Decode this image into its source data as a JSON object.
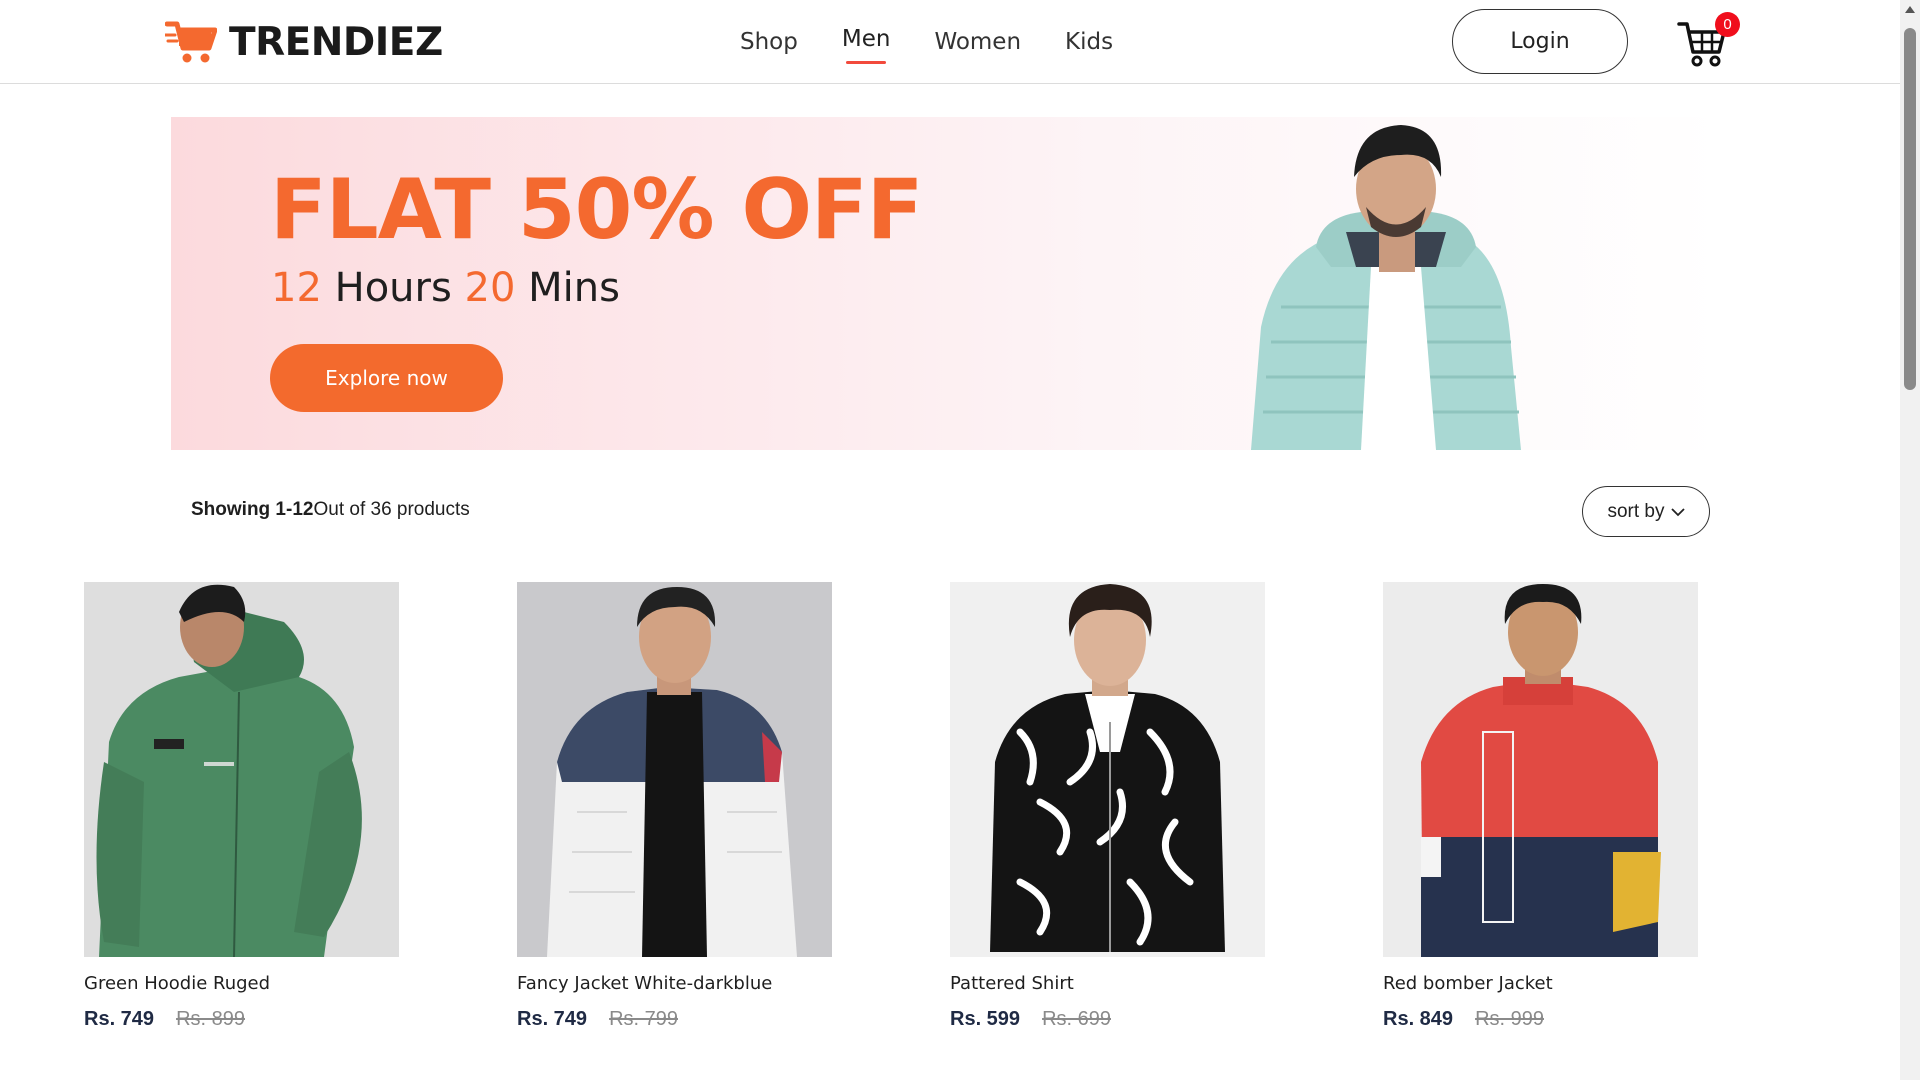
{
  "header": {
    "brand": "TRENDIEZ",
    "nav": [
      {
        "label": "Shop",
        "active": false
      },
      {
        "label": "Men",
        "active": true
      },
      {
        "label": "Women",
        "active": false
      },
      {
        "label": "Kids",
        "active": false
      }
    ],
    "login_label": "Login",
    "cart_count": "0"
  },
  "banner": {
    "title": "FLAT 50% OFF",
    "hours_value": "12",
    "hours_label": "Hours",
    "mins_value": "20",
    "mins_label": "Mins",
    "cta_label": "Explore now"
  },
  "listing": {
    "showing_bold": "Showing 1-12",
    "showing_rest": "Out of 36 products",
    "sort_label": "sort by"
  },
  "products": [
    {
      "name": "Green Hoodie Ruged",
      "price": "Rs. 749",
      "old_price": "Rs. 899"
    },
    {
      "name": "Fancy Jacket White-darkblue",
      "price": "Rs. 749",
      "old_price": "Rs. 799"
    },
    {
      "name": "Pattered Shirt",
      "price": "Rs. 599",
      "old_price": "Rs. 699"
    },
    {
      "name": "Red bomber Jacket",
      "price": "Rs. 849",
      "old_price": "Rs. 999"
    }
  ],
  "colors": {
    "accent": "#f4692f",
    "nav_underline": "#f24a3c",
    "cart_badge": "#f00e1c",
    "price_text": "#1f2a44"
  }
}
